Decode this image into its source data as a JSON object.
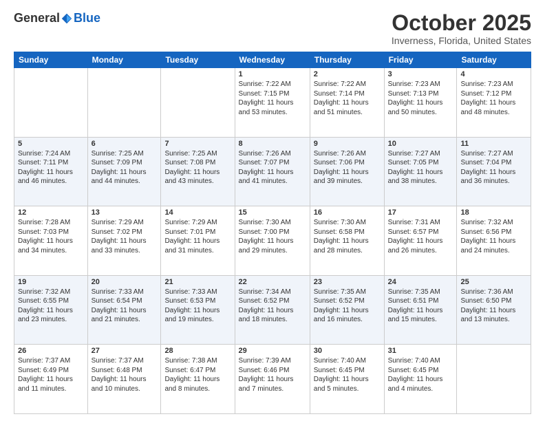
{
  "logo": {
    "general": "General",
    "blue": "Blue"
  },
  "header": {
    "month": "October 2025",
    "location": "Inverness, Florida, United States"
  },
  "days": [
    "Sunday",
    "Monday",
    "Tuesday",
    "Wednesday",
    "Thursday",
    "Friday",
    "Saturday"
  ],
  "weeks": [
    [
      {
        "day": "",
        "text": ""
      },
      {
        "day": "",
        "text": ""
      },
      {
        "day": "",
        "text": ""
      },
      {
        "day": "1",
        "text": "Sunrise: 7:22 AM\nSunset: 7:15 PM\nDaylight: 11 hours and 53 minutes."
      },
      {
        "day": "2",
        "text": "Sunrise: 7:22 AM\nSunset: 7:14 PM\nDaylight: 11 hours and 51 minutes."
      },
      {
        "day": "3",
        "text": "Sunrise: 7:23 AM\nSunset: 7:13 PM\nDaylight: 11 hours and 50 minutes."
      },
      {
        "day": "4",
        "text": "Sunrise: 7:23 AM\nSunset: 7:12 PM\nDaylight: 11 hours and 48 minutes."
      }
    ],
    [
      {
        "day": "5",
        "text": "Sunrise: 7:24 AM\nSunset: 7:11 PM\nDaylight: 11 hours and 46 minutes."
      },
      {
        "day": "6",
        "text": "Sunrise: 7:25 AM\nSunset: 7:09 PM\nDaylight: 11 hours and 44 minutes."
      },
      {
        "day": "7",
        "text": "Sunrise: 7:25 AM\nSunset: 7:08 PM\nDaylight: 11 hours and 43 minutes."
      },
      {
        "day": "8",
        "text": "Sunrise: 7:26 AM\nSunset: 7:07 PM\nDaylight: 11 hours and 41 minutes."
      },
      {
        "day": "9",
        "text": "Sunrise: 7:26 AM\nSunset: 7:06 PM\nDaylight: 11 hours and 39 minutes."
      },
      {
        "day": "10",
        "text": "Sunrise: 7:27 AM\nSunset: 7:05 PM\nDaylight: 11 hours and 38 minutes."
      },
      {
        "day": "11",
        "text": "Sunrise: 7:27 AM\nSunset: 7:04 PM\nDaylight: 11 hours and 36 minutes."
      }
    ],
    [
      {
        "day": "12",
        "text": "Sunrise: 7:28 AM\nSunset: 7:03 PM\nDaylight: 11 hours and 34 minutes."
      },
      {
        "day": "13",
        "text": "Sunrise: 7:29 AM\nSunset: 7:02 PM\nDaylight: 11 hours and 33 minutes."
      },
      {
        "day": "14",
        "text": "Sunrise: 7:29 AM\nSunset: 7:01 PM\nDaylight: 11 hours and 31 minutes."
      },
      {
        "day": "15",
        "text": "Sunrise: 7:30 AM\nSunset: 7:00 PM\nDaylight: 11 hours and 29 minutes."
      },
      {
        "day": "16",
        "text": "Sunrise: 7:30 AM\nSunset: 6:58 PM\nDaylight: 11 hours and 28 minutes."
      },
      {
        "day": "17",
        "text": "Sunrise: 7:31 AM\nSunset: 6:57 PM\nDaylight: 11 hours and 26 minutes."
      },
      {
        "day": "18",
        "text": "Sunrise: 7:32 AM\nSunset: 6:56 PM\nDaylight: 11 hours and 24 minutes."
      }
    ],
    [
      {
        "day": "19",
        "text": "Sunrise: 7:32 AM\nSunset: 6:55 PM\nDaylight: 11 hours and 23 minutes."
      },
      {
        "day": "20",
        "text": "Sunrise: 7:33 AM\nSunset: 6:54 PM\nDaylight: 11 hours and 21 minutes."
      },
      {
        "day": "21",
        "text": "Sunrise: 7:33 AM\nSunset: 6:53 PM\nDaylight: 11 hours and 19 minutes."
      },
      {
        "day": "22",
        "text": "Sunrise: 7:34 AM\nSunset: 6:52 PM\nDaylight: 11 hours and 18 minutes."
      },
      {
        "day": "23",
        "text": "Sunrise: 7:35 AM\nSunset: 6:52 PM\nDaylight: 11 hours and 16 minutes."
      },
      {
        "day": "24",
        "text": "Sunrise: 7:35 AM\nSunset: 6:51 PM\nDaylight: 11 hours and 15 minutes."
      },
      {
        "day": "25",
        "text": "Sunrise: 7:36 AM\nSunset: 6:50 PM\nDaylight: 11 hours and 13 minutes."
      }
    ],
    [
      {
        "day": "26",
        "text": "Sunrise: 7:37 AM\nSunset: 6:49 PM\nDaylight: 11 hours and 11 minutes."
      },
      {
        "day": "27",
        "text": "Sunrise: 7:37 AM\nSunset: 6:48 PM\nDaylight: 11 hours and 10 minutes."
      },
      {
        "day": "28",
        "text": "Sunrise: 7:38 AM\nSunset: 6:47 PM\nDaylight: 11 hours and 8 minutes."
      },
      {
        "day": "29",
        "text": "Sunrise: 7:39 AM\nSunset: 6:46 PM\nDaylight: 11 hours and 7 minutes."
      },
      {
        "day": "30",
        "text": "Sunrise: 7:40 AM\nSunset: 6:45 PM\nDaylight: 11 hours and 5 minutes."
      },
      {
        "day": "31",
        "text": "Sunrise: 7:40 AM\nSunset: 6:45 PM\nDaylight: 11 hours and 4 minutes."
      },
      {
        "day": "",
        "text": ""
      }
    ]
  ]
}
